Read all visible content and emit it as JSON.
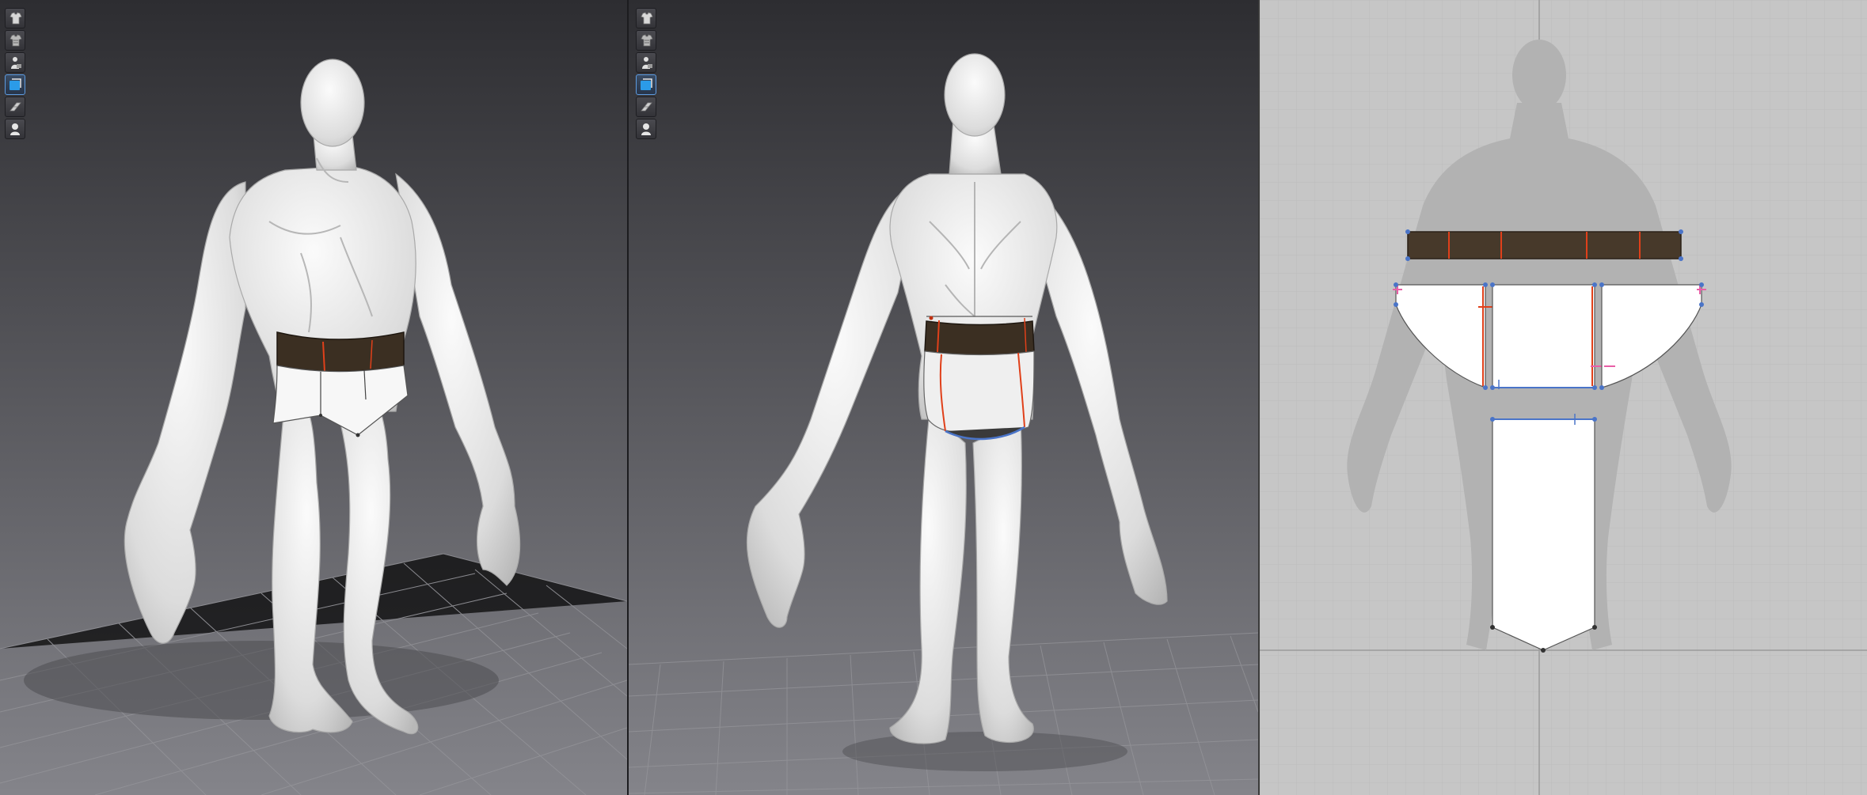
{
  "app": {
    "panels": [
      "3d-front-view",
      "3d-back-view",
      "2d-pattern-window"
    ]
  },
  "colors": {
    "viewport_top": "#2d2d31",
    "viewport_bottom": "#7e7e84",
    "floor_grid": "#8a8a90",
    "avatar": "#e8e8e8",
    "belt": "#3b2f22",
    "garment": "#ffffff",
    "seam_red": "#e0401a",
    "seam_pink": "#e85fa6",
    "point_blue": "#4a74c8",
    "pattern_bg": "#c6c6c6",
    "pattern_grid": "#b9b9b9",
    "avatar_silhouette": "#b0b0b0"
  },
  "toolbar": {
    "tools": [
      {
        "icon": "garment-display-icon",
        "active": false
      },
      {
        "icon": "garment-texture-icon",
        "active": false
      },
      {
        "icon": "avatar-display-icon",
        "active": false
      },
      {
        "icon": "fabric-solid-icon",
        "active": true
      },
      {
        "icon": "mesh-display-icon",
        "active": false
      },
      {
        "icon": "avatar-skin-icon",
        "active": false
      }
    ]
  }
}
